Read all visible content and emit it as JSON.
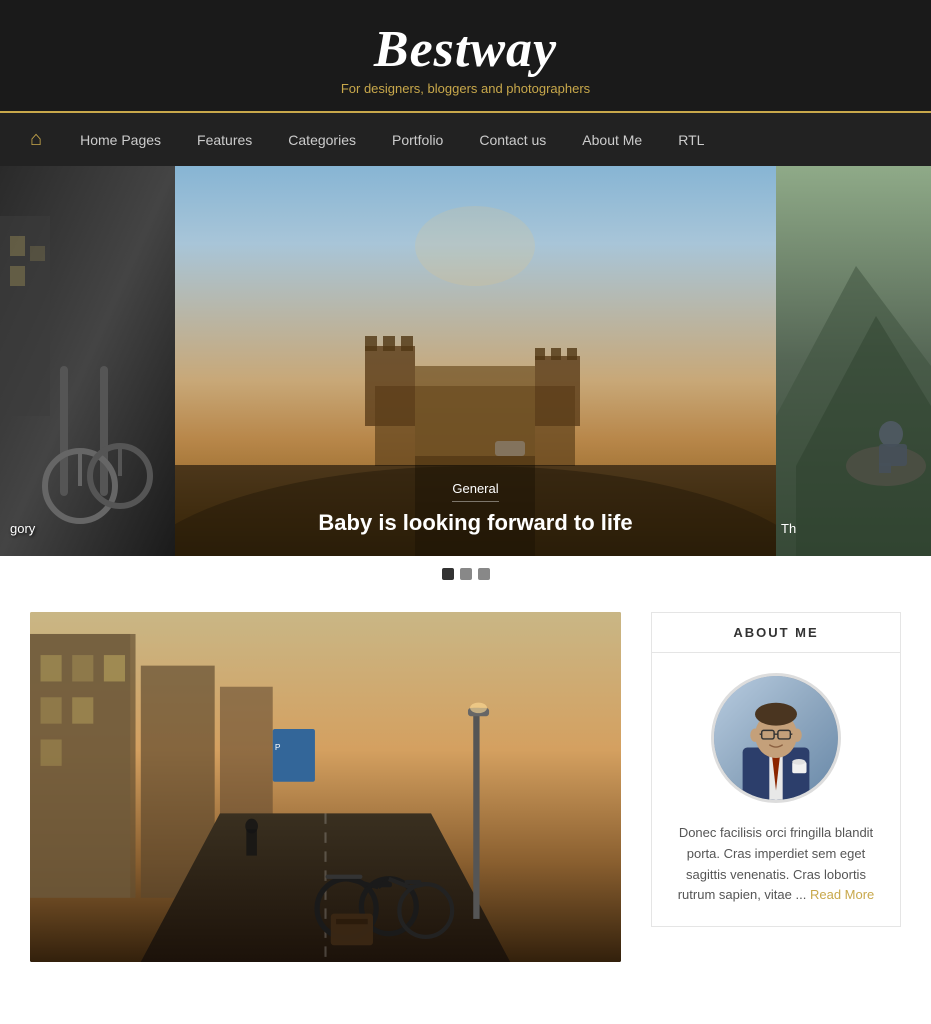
{
  "header": {
    "title": "Bestway",
    "tagline": "For designers, bloggers and photographers"
  },
  "nav": {
    "home_icon": "🏠",
    "items": [
      {
        "label": "Home Pages",
        "href": "#"
      },
      {
        "label": "Features",
        "href": "#"
      },
      {
        "label": "Categories",
        "href": "#"
      },
      {
        "label": "Portfolio",
        "href": "#"
      },
      {
        "label": "Contact us",
        "href": "#"
      },
      {
        "label": "About Me",
        "href": "#"
      },
      {
        "label": "RTL",
        "href": "#"
      }
    ]
  },
  "slider": {
    "left_label": "gory",
    "center": {
      "category": "General",
      "title": "Baby is looking forward to life"
    },
    "right_label": "Th",
    "dots": [
      {
        "active": true
      },
      {
        "active": false
      },
      {
        "active": false
      }
    ]
  },
  "sidebar": {
    "about_me": {
      "title": "ABOUT ME",
      "description": "Donec facilisis orci fringilla blandit porta. Cras imperdiet sem eget sagittis venenatis. Cras lobortis rutrum sapien, vitae ...",
      "read_more": "Read More"
    }
  }
}
